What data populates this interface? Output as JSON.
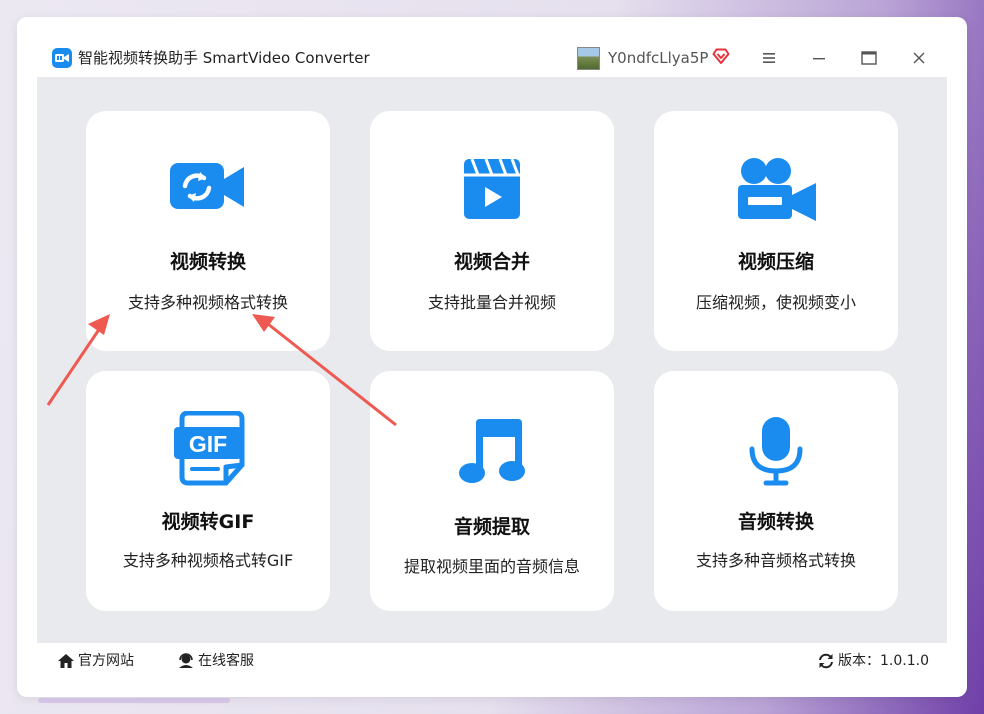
{
  "app": {
    "title": "智能视频转换助手 SmartVideo Converter",
    "logo_text": "视频"
  },
  "user": {
    "name": "Y0ndfcLlya5P"
  },
  "colors": {
    "accent": "#1a8cf0",
    "vip": "#e8333c",
    "annotation_arrow": "#ee5a52"
  },
  "cards": [
    {
      "title": "视频转换",
      "desc": "支持多种视频格式转换",
      "icon": "video-convert-icon"
    },
    {
      "title": "视频合并",
      "desc": "支持批量合并视频",
      "icon": "video-merge-icon"
    },
    {
      "title": "视频压缩",
      "desc": "压缩视频，使视频变小",
      "icon": "video-compress-icon"
    },
    {
      "title": "视频转GIF",
      "desc": "支持多种视频格式转GIF",
      "icon": "gif-icon",
      "icon_text": "GIF"
    },
    {
      "title": "音频提取",
      "desc": "提取视频里面的音频信息",
      "icon": "music-note-icon"
    },
    {
      "title": "音频转换",
      "desc": "支持多种音频格式转换",
      "icon": "microphone-icon"
    }
  ],
  "footer": {
    "website": "官方网站",
    "service": "在线客服",
    "version": "版本：1.0.1.0"
  }
}
